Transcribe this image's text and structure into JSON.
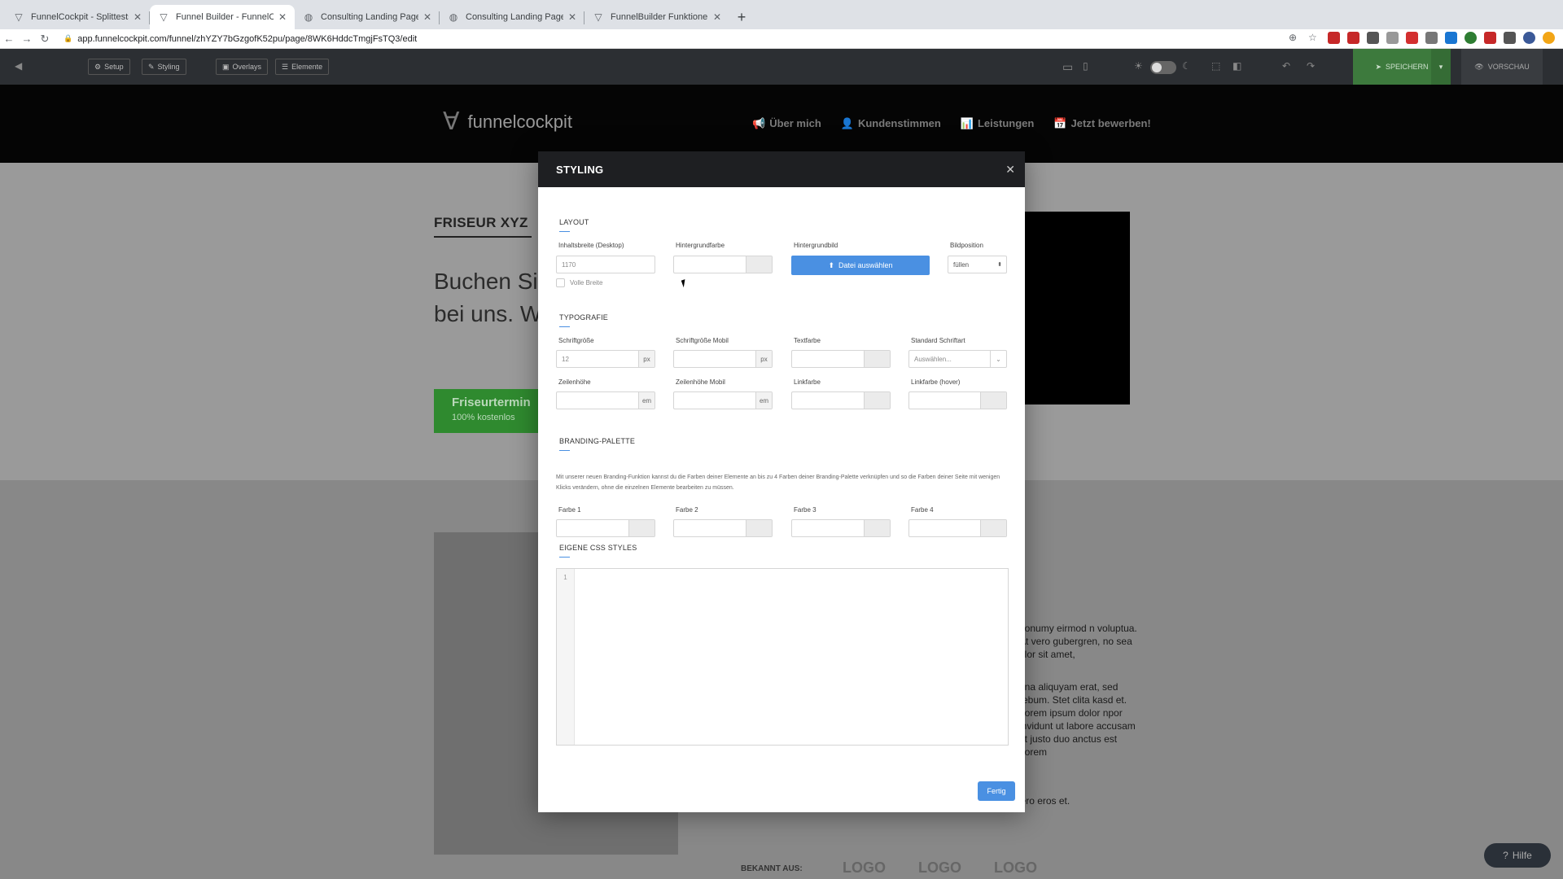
{
  "browser": {
    "tabs": [
      {
        "title": "FunnelCockpit - Splittests, Ma",
        "icon": "funnel-icon",
        "active": false
      },
      {
        "title": "Funnel Builder - FunnelCockpit",
        "icon": "funnel-icon",
        "active": true
      },
      {
        "title": "Consulting Landing Page",
        "icon": "globe-icon",
        "active": false
      },
      {
        "title": "Consulting Landing Page",
        "icon": "globe-icon",
        "active": false
      },
      {
        "title": "FunnelBuilder Funktionen & Ei",
        "icon": "funnel-icon",
        "active": false
      }
    ],
    "url": "app.funnelcockpit.com/funnel/zhYZY7bGzgofK52pu/page/8WK6HddcTmgjFsTQ3/edit"
  },
  "toolbar": {
    "setup": "Setup",
    "styling": "Styling",
    "overlays": "Overlays",
    "elemente": "Elemente",
    "speichern": "SPEICHERN",
    "vorschau": "VORSCHAU"
  },
  "site": {
    "logo": "funnelcockpit",
    "nav": [
      "Über mich",
      "Kundenstimmen",
      "Leistungen",
      "Jetzt bewerben!"
    ],
    "kicker": "FRISEUR XYZ",
    "headline": "Buchen Si Ihren näch bei uns. W",
    "cta_title": "Friseurtermin",
    "cta_sub": "100% kostenlos",
    "lorem_1": "nonumy eirmod n voluptua. At vero gubergren, no sea olor sit amet,",
    "lorem_2": "gna aliquyam erat, sed rebum. Stet clita kasd et. Lorem ipsum dolor npor invidunt ut labore accusam et justo duo anctus est Lorem",
    "lorem_3": "se molestie consequat, vel illum dolore eu feugiat nulla facilisis at vero eros et.",
    "bekannt": "BEKANNT AUS:",
    "logo_placeholder": "LOGO",
    "help": "Hilfe"
  },
  "modal": {
    "title": "STYLING",
    "layout": {
      "heading": "LAYOUT",
      "inhaltsbreite_label": "Inhaltsbreite (Desktop)",
      "inhaltsbreite_placeholder": "1170",
      "hintergrundfarbe_label": "Hintergrundfarbe",
      "hintergrundbild_label": "Hintergrundbild",
      "file_button": "Datei auswählen",
      "bildposition_label": "Bildposition",
      "bildposition_value": "füllen",
      "volle_breite": "Volle Breite"
    },
    "typografie": {
      "heading": "TYPOGRAFIE",
      "schriftgroesse_label": "Schriftgröße",
      "schriftgroesse_placeholder": "12",
      "schriftgroesse_mobil_label": "Schriftgröße Mobil",
      "textfarbe_label": "Textfarbe",
      "schriftart_label": "Standard Schriftart",
      "schriftart_value": "Auswählen...",
      "zeilenhoehe_label": "Zeilenhöhe",
      "zeilenhoehe_mobil_label": "Zeilenhöhe Mobil",
      "linkfarbe_label": "Linkfarbe",
      "linkfarbe_hover_label": "Linkfarbe (hover)",
      "unit_px": "px",
      "unit_em": "em"
    },
    "branding": {
      "heading": "BRANDING-PALETTE",
      "description": "Mit unserer neuen Branding-Funktion kannst du die Farben deiner Elemente an bis zu 4 Farben deiner Branding-Palette verknüpfen und so die Farben deiner Seite mit wenigen Klicks verändern, ohne die einzelnen Elemente bearbeiten zu müssen.",
      "farbe1": "Farbe 1",
      "farbe2": "Farbe 2",
      "farbe3": "Farbe 3",
      "farbe4": "Farbe 4"
    },
    "css": {
      "heading": "EIGENE CSS STYLES",
      "line_number": "1"
    },
    "done_button": "Fertig"
  },
  "colors": {
    "accent": "#4a90e2",
    "save_green": "#3d7a3d",
    "cta_green": "#2f8a2f",
    "modal_header": "#1e1f22"
  }
}
